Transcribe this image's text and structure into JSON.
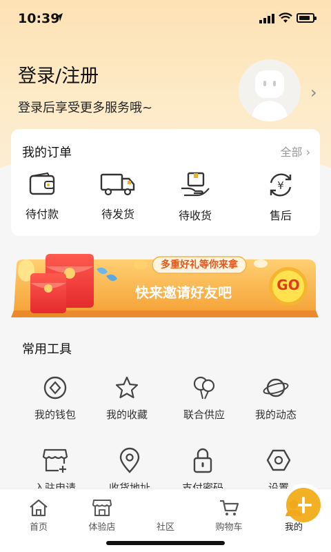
{
  "status": {
    "time": "10:39"
  },
  "header": {
    "title": "登录/注册",
    "subtitle": "登录后享受更多服务哦~"
  },
  "orders": {
    "title": "我的订单",
    "more": "全部 ›",
    "items": [
      {
        "label": "待付款",
        "icon": "wallet-icon"
      },
      {
        "label": "待发货",
        "icon": "truck-icon"
      },
      {
        "label": "待收货",
        "icon": "package-hand-icon"
      },
      {
        "label": "售后",
        "icon": "yen-refresh-icon"
      }
    ]
  },
  "banner": {
    "tag": "多重好礼等你来拿",
    "text": "快来邀请好友吧",
    "go": "GO"
  },
  "tools": {
    "title": "常用工具",
    "items": [
      {
        "label": "我的钱包",
        "icon": "wallet-diamond-icon"
      },
      {
        "label": "我的收藏",
        "icon": "star-icon"
      },
      {
        "label": "联合供应",
        "icon": "balloons-icon"
      },
      {
        "label": "我的动态",
        "icon": "planet-icon"
      },
      {
        "label": "入驻申请",
        "icon": "store-add-icon"
      },
      {
        "label": "收货地址",
        "icon": "location-pin-icon"
      },
      {
        "label": "支付密码",
        "icon": "lock-icon"
      },
      {
        "label": "设置",
        "icon": "settings-hex-icon"
      }
    ]
  },
  "tabbar": {
    "items": [
      {
        "label": "首页"
      },
      {
        "label": "体验店"
      },
      {
        "label": "社区"
      },
      {
        "label": "购物车"
      },
      {
        "label": "我的"
      }
    ],
    "active_color": "#f2a81d"
  },
  "colors": {
    "accent": "#f2b124",
    "hero": "#fde2b4"
  }
}
